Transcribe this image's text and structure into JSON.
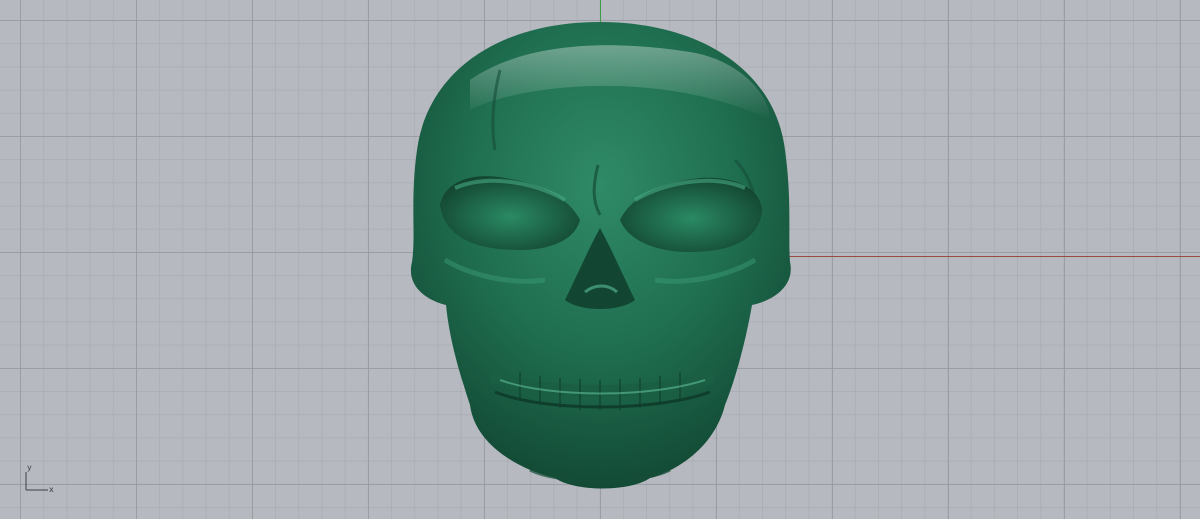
{
  "viewport": {
    "background_color": "#b6bac0",
    "grid_color": "#969aa0",
    "axis_x_color": "#9b4a42",
    "axis_y_color": "#3e9b48"
  },
  "model": {
    "icon": "skull-model",
    "color": "#1d6b4e"
  },
  "gizmo": {
    "y_label": "y",
    "x_label": "x"
  }
}
